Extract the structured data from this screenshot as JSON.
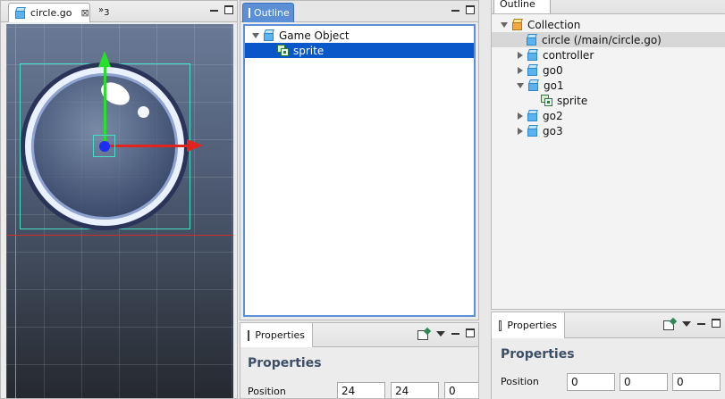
{
  "editor": {
    "tab_title": "circle.go",
    "overflow_count": "3"
  },
  "outline": {
    "tab_title": "Outline",
    "items": [
      {
        "label": "Game Object"
      },
      {
        "label": "sprite"
      }
    ]
  },
  "properties": {
    "tab_title": "Properties",
    "title": "Properties",
    "position_label": "Position",
    "position": [
      "24",
      "24",
      "0"
    ]
  },
  "right_outline": {
    "tab_title": "Outline",
    "items": [
      {
        "label": "Collection"
      },
      {
        "label": "circle (/main/circle.go)"
      },
      {
        "label": "controller"
      },
      {
        "label": "go0"
      },
      {
        "label": "go1"
      },
      {
        "label": "sprite"
      },
      {
        "label": "go2"
      },
      {
        "label": "go3"
      }
    ]
  },
  "right_properties": {
    "tab_title": "Properties",
    "title": "Properties",
    "position_label": "Position",
    "position": [
      "0",
      "0",
      "0"
    ]
  },
  "colors": {
    "selection": "#0a57c9",
    "accent": "#5b8fd6",
    "x_axis": "#e0241e",
    "y_axis": "#27e02b"
  }
}
